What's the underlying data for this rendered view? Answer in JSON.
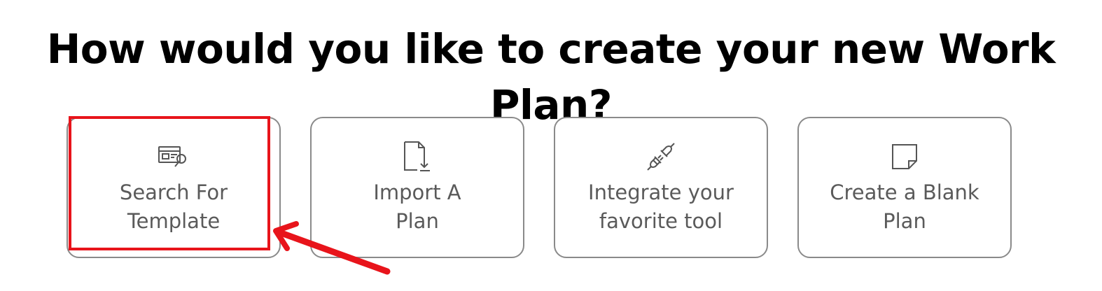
{
  "title": "How would you like to create your new Work Plan?",
  "cards": [
    {
      "icon": "template-search-icon",
      "line1": "Search For",
      "line2": "Template"
    },
    {
      "icon": "import-file-icon",
      "line1": "Import A",
      "line2": "Plan"
    },
    {
      "icon": "plug-connector-icon",
      "line1": "Integrate your",
      "line2": "favorite tool"
    },
    {
      "icon": "blank-note-icon",
      "line1": "Create a Blank",
      "line2": "Plan"
    }
  ],
  "colors": {
    "title": "#000000",
    "card_border": "#8a8a8a",
    "card_text": "#5a5a5a",
    "annotation": "#e8141b"
  }
}
